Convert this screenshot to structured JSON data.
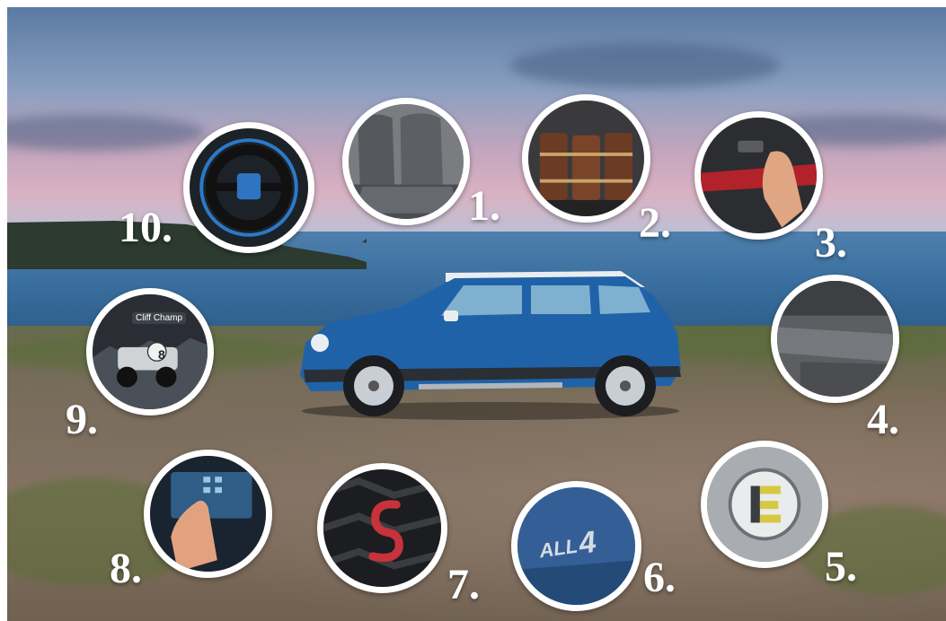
{
  "labels": {
    "n1": "1.",
    "n2": "2.",
    "n3": "3.",
    "n4": "4.",
    "n5": "5.",
    "n6": "6.",
    "n7": "7.",
    "n8": "8.",
    "n9": "9.",
    "n10": "10."
  },
  "badges": {
    "all4": "ALL",
    "all4_num": "4",
    "game_title": "Cliff Champ",
    "game_number": "8"
  },
  "colors": {
    "car_body": "#1f62a8",
    "car_roof": "#e9edf0",
    "s_badge": "#c8323a",
    "charge_yellow": "#d7c842"
  }
}
